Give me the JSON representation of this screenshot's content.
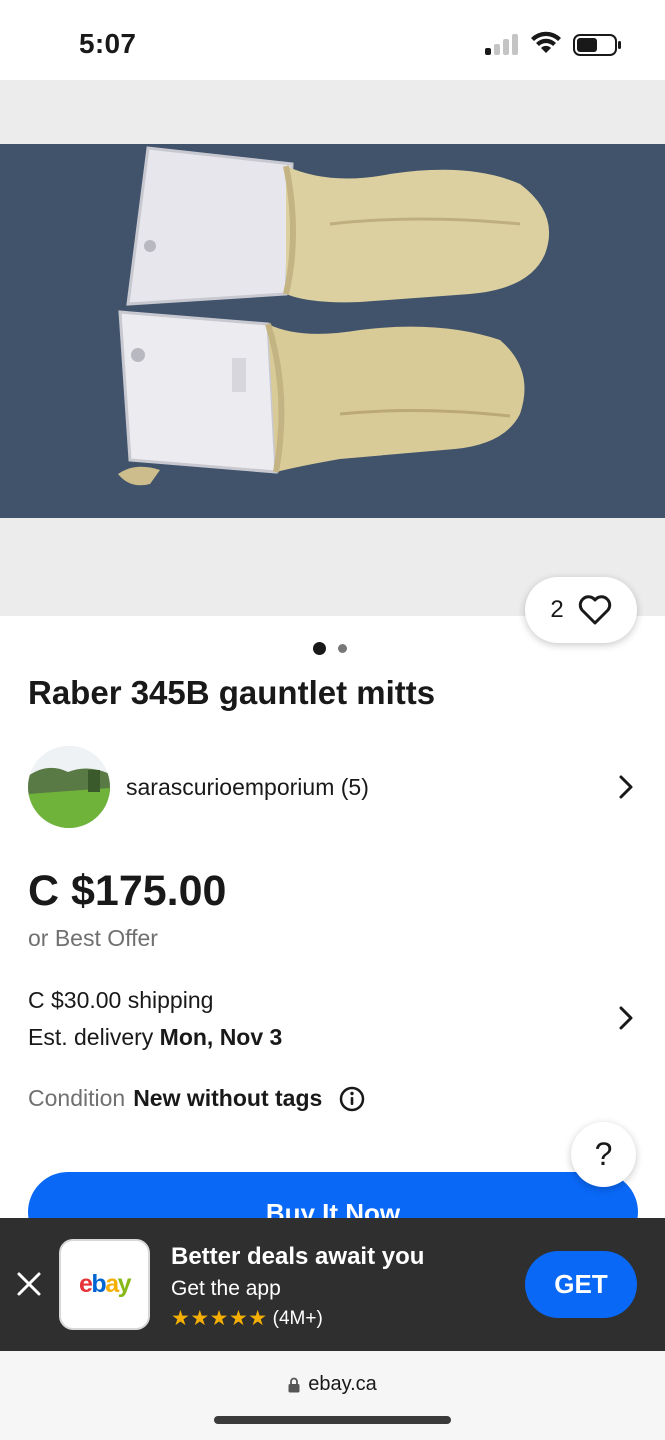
{
  "status_bar": {
    "time": "5:07"
  },
  "listing": {
    "title": "Raber 345B gauntlet mitts",
    "watch_count": "2",
    "image_count": 2,
    "active_image": 1,
    "seller": {
      "name_rating": "sarascurioemporium (5)"
    },
    "price": "C $175.00",
    "best_offer": "or Best Offer",
    "shipping": "C $30.00 shipping",
    "delivery_label": "Est. delivery",
    "delivery_date": "Mon, Nov 3",
    "condition_label": "Condition",
    "condition_value": "New without tags",
    "help_label": "?",
    "buy_button": "Buy It Now"
  },
  "app_banner": {
    "logo_text": "ebay",
    "title": "Better deals await you",
    "subtitle": "Get the app",
    "stars": "★★★★★",
    "rating_count": "(4M+)",
    "get_button": "GET"
  },
  "browser": {
    "url": "ebay.ca"
  },
  "colors": {
    "accent": "#0968f6",
    "banner_bg": "#2f2f2f",
    "star": "#f5af02"
  }
}
